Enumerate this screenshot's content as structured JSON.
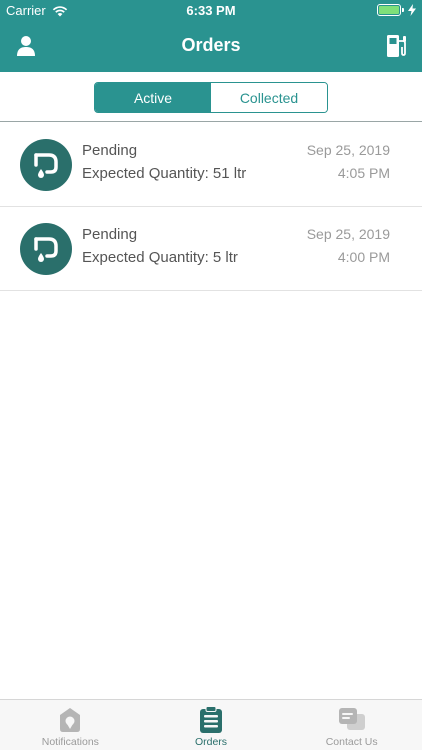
{
  "status_bar": {
    "carrier": "Carrier",
    "time": "6:33 PM"
  },
  "nav": {
    "title": "Orders",
    "left_icon": "user-icon",
    "right_icon": "fuel-pump-icon"
  },
  "segments": {
    "active_label": "Active",
    "collected_label": "Collected",
    "selected": "Active"
  },
  "orders": [
    {
      "status": "Pending",
      "quantity": "Expected Quantity: 51 ltr",
      "date": "Sep 25, 2019",
      "time": "4:05 PM",
      "icon": "fuel-drop-icon"
    },
    {
      "status": "Pending",
      "quantity": "Expected Quantity: 5 ltr",
      "date": "Sep 25, 2019",
      "time": "4:00 PM",
      "icon": "fuel-drop-icon"
    }
  ],
  "tabs": [
    {
      "label": "Notifications",
      "icon": "notification-pin-icon",
      "selected": false
    },
    {
      "label": "Orders",
      "icon": "clipboard-icon",
      "selected": true
    },
    {
      "label": "Contact Us",
      "icon": "chat-bubbles-icon",
      "selected": false
    }
  ],
  "colors": {
    "primary": "#2a9390",
    "avatar": "#2a6f6b",
    "tab_inactive": "#9a9a9a"
  }
}
